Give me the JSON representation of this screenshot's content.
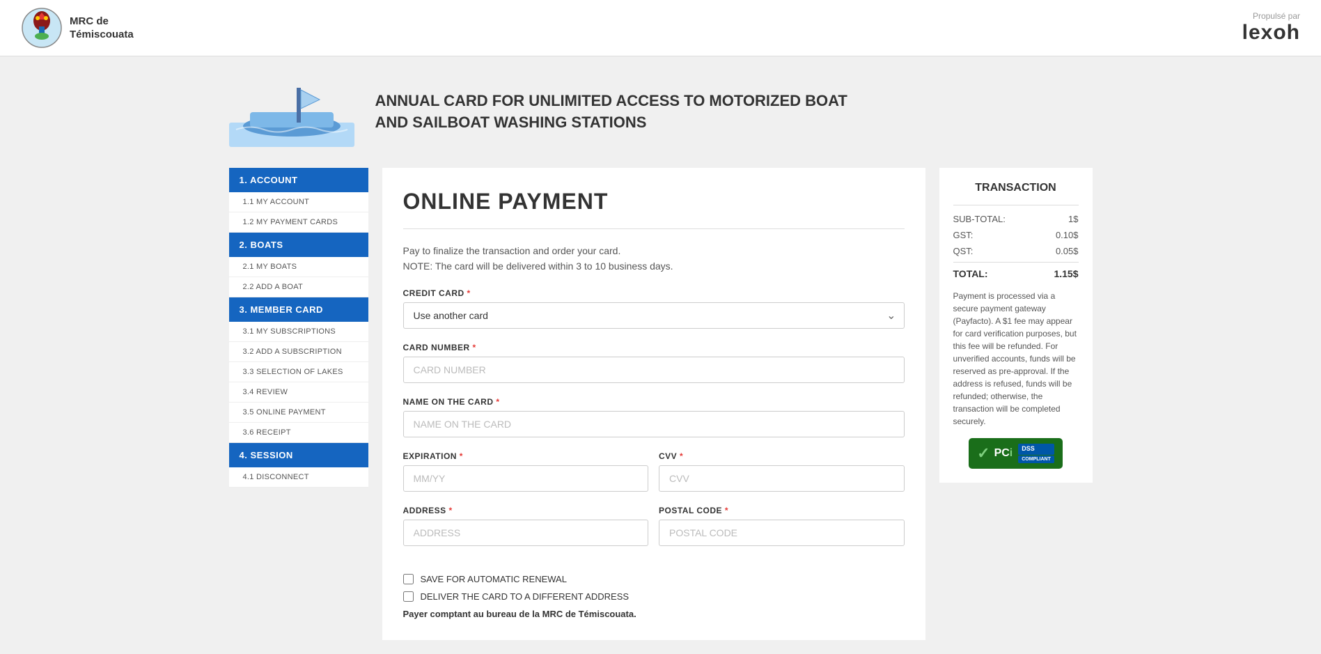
{
  "header": {
    "logo_line1": "MRC de",
    "logo_line2": "Témiscouata",
    "powered_by": "Propulsé par",
    "brand": "lexoh"
  },
  "product": {
    "title_line1": "ANNUAL CARD FOR UNLIMITED ACCESS TO MOTORIZED BOAT",
    "title_line2": "AND SAILBOAT WASHING STATIONS"
  },
  "sidebar": {
    "sections": [
      {
        "label": "1. ACCOUNT",
        "items": [
          "1.1  MY ACCOUNT",
          "1.2  MY PAYMENT CARDS"
        ]
      },
      {
        "label": "2. BOATS",
        "items": [
          "2.1  MY BOATS",
          "2.2  ADD A BOAT"
        ]
      },
      {
        "label": "3. MEMBER CARD",
        "items": [
          "3.1  MY SUBSCRIPTIONS",
          "3.2  ADD A SUBSCRIPTION",
          "3.3  SELECTION OF LAKES",
          "3.4  REVIEW",
          "3.5  ONLINE PAYMENT",
          "3.6  RECEIPT"
        ]
      },
      {
        "label": "4. SESSION",
        "items": [
          "4.1  DISCONNECT"
        ]
      }
    ]
  },
  "main": {
    "page_title": "ONLINE PAYMENT",
    "intro_line1": "Pay to finalize the transaction and order your card.",
    "intro_line2": "NOTE: The card will be delivered within 3 to 10 business days.",
    "credit_card_label": "Credit card",
    "credit_card_option": "Use another card",
    "card_number_label": "CARD NUMBER",
    "card_number_placeholder": "CARD NUMBER",
    "name_on_card_label": "NAME ON THE CARD",
    "name_on_card_placeholder": "NAME ON THE CARD",
    "expiration_label": "EXPIRATION",
    "expiration_placeholder": "MM/YY",
    "cvv_label": "CVV",
    "cvv_placeholder": "CVV",
    "address_label": "ADDRESS",
    "address_placeholder": "ADDRESS",
    "postal_code_label": "POSTAL CODE",
    "postal_code_placeholder": "POSTAL CODE",
    "checkbox_renewal": "SAVE FOR AUTOMATIC RENEWAL",
    "checkbox_deliver": "DELIVER THE CARD TO A DIFFERENT ADDRESS",
    "cash_note": "Payer comptant au bureau de la MRC de Témiscouata."
  },
  "transaction": {
    "title": "TRANSACTION",
    "subtotal_label": "SUB-TOTAL:",
    "subtotal_value": "1$",
    "gst_label": "GST:",
    "gst_value": "0.10$",
    "qst_label": "QST:",
    "qst_value": "0.05$",
    "total_label": "TOTAL:",
    "total_value": "1.15$",
    "note": "Payment is processed via a secure payment gateway (Payfacto). A $1 fee may appear for card verification purposes, but this fee will be refunded. For unverified accounts, funds will be reserved as pre-approval. If the address is refused, funds will be refunded; otherwise, the transaction will be completed securely.",
    "pci_label": "PCI",
    "dss_label": "DSS\nCOMPLIANT"
  }
}
